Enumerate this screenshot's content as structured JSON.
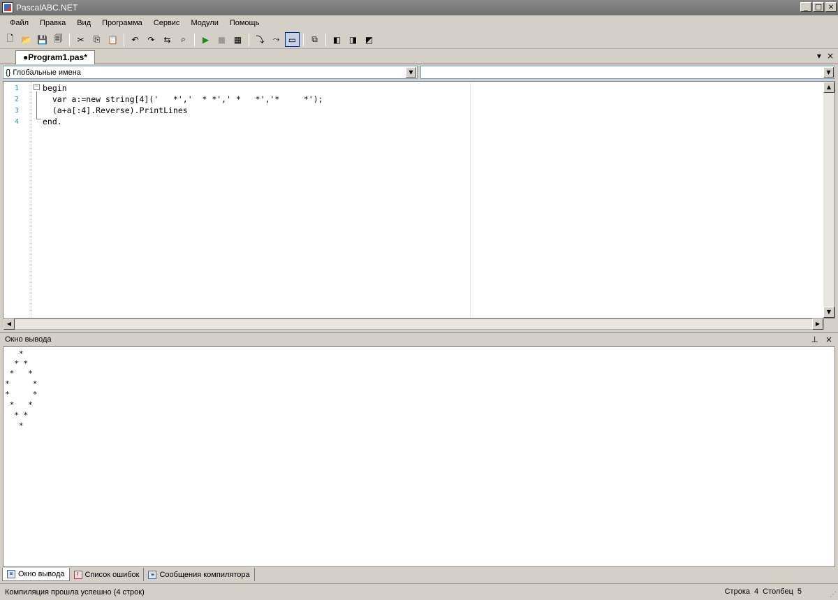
{
  "window": {
    "title": "PascalABC.NET",
    "controls": [
      "_",
      "□",
      "×"
    ]
  },
  "menu": [
    "Файл",
    "Правка",
    "Вид",
    "Программа",
    "Сервис",
    "Модули",
    "Помощь"
  ],
  "toolbar": {
    "buttons": [
      {
        "name": "new-file-icon",
        "glyph": "🗋"
      },
      {
        "name": "open-file-icon",
        "glyph": "📂"
      },
      {
        "name": "save-icon",
        "glyph": "💾"
      },
      {
        "name": "save-all-icon",
        "glyph": "🗐"
      },
      {
        "sep": true
      },
      {
        "name": "cut-icon",
        "glyph": "✂"
      },
      {
        "name": "copy-icon",
        "glyph": "⎘"
      },
      {
        "name": "paste-icon",
        "glyph": "📋"
      },
      {
        "sep": true
      },
      {
        "name": "undo-icon",
        "glyph": "↶"
      },
      {
        "name": "redo-icon",
        "glyph": "↷"
      },
      {
        "name": "format-icon",
        "glyph": "⇆"
      },
      {
        "name": "find-icon",
        "glyph": "⌕"
      },
      {
        "sep": true
      },
      {
        "name": "run-icon",
        "glyph": "▶"
      },
      {
        "name": "stop-icon",
        "glyph": "■"
      },
      {
        "name": "build-icon",
        "glyph": "▦"
      },
      {
        "sep": true
      },
      {
        "name": "step-into-icon",
        "glyph": "⤵"
      },
      {
        "name": "step-over-icon",
        "glyph": "⤳"
      },
      {
        "name": "console-icon",
        "glyph": "▭",
        "pressed": true
      },
      {
        "sep": true
      },
      {
        "name": "debug-icon",
        "glyph": "⧉"
      },
      {
        "sep": true
      },
      {
        "name": "module-icon-1",
        "glyph": "◧"
      },
      {
        "name": "module-icon-2",
        "glyph": "◨"
      },
      {
        "name": "module-icon-3",
        "glyph": "◩"
      }
    ]
  },
  "editor_tab": {
    "label": "●Program1.pas*",
    "controls": [
      "▾",
      "×"
    ]
  },
  "nav": {
    "left_combo": "{} Глобальные имена",
    "right_combo": ""
  },
  "code": {
    "line_numbers": [
      "1",
      "2",
      "3",
      "4"
    ],
    "lines": [
      "begin",
      "  var a:=new string[4]('   *','  * *',' *   *','*     *');",
      "  (a+a[:4].Reverse).PrintLines",
      "end."
    ]
  },
  "output_panel": {
    "title": "Окно вывода",
    "controls": [
      "⊥",
      "×"
    ],
    "lines": [
      "   *",
      "  * *",
      " *   *",
      "*     *",
      "*     *",
      " *   *",
      "  * *",
      "   *"
    ]
  },
  "bottom_tabs": [
    "Окно вывода",
    "Список ошибок",
    "Сообщения компилятора"
  ],
  "status": {
    "message": "Компиляция прошла успешно (4 строк)",
    "row_label": "Строка",
    "row": "4",
    "col_label": "Столбец",
    "col": "5"
  }
}
